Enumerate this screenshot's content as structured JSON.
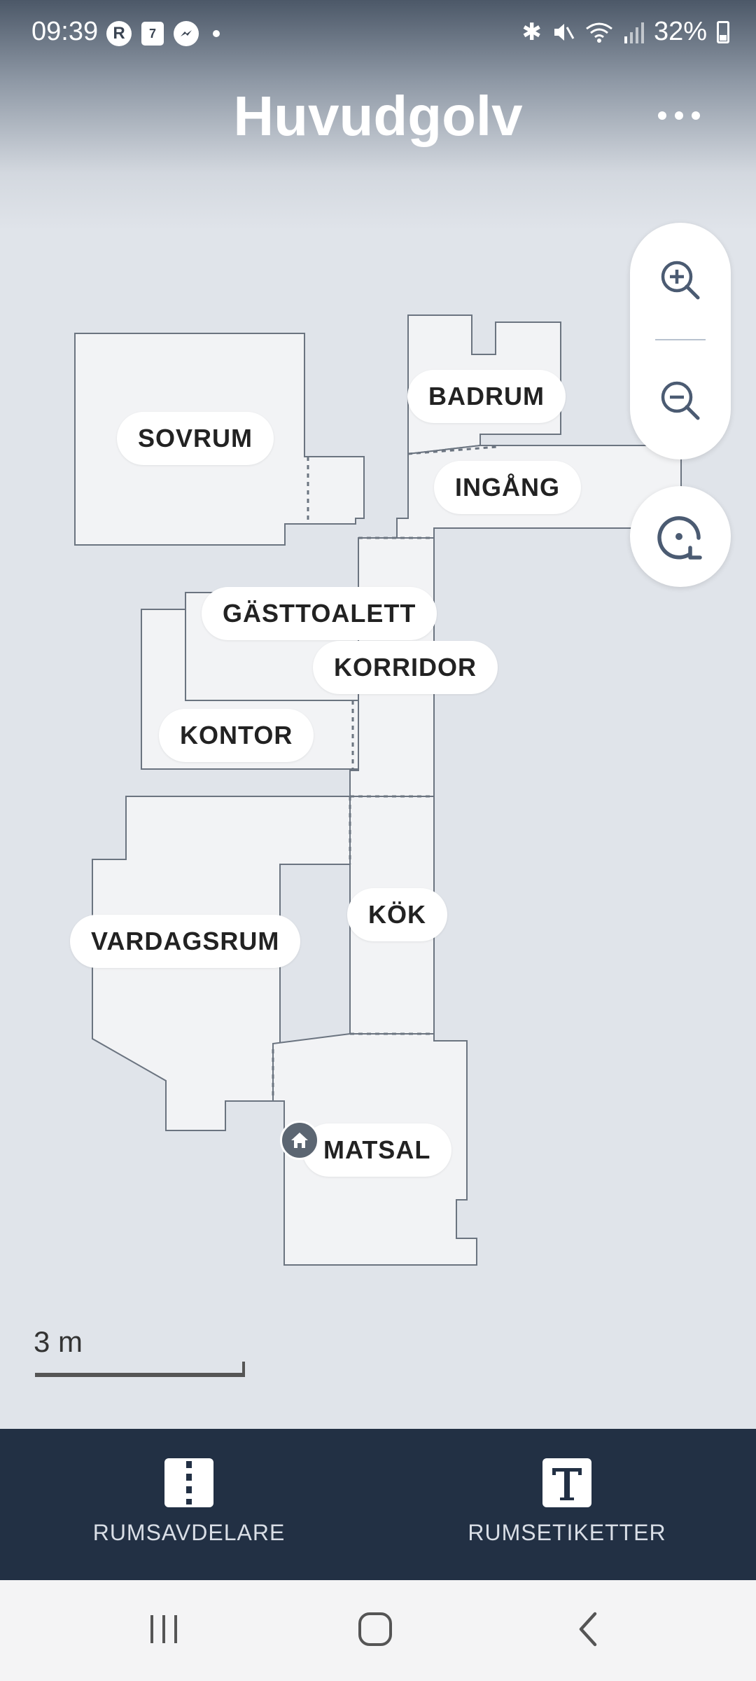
{
  "status_bar": {
    "time": "09:39",
    "notifications": [
      {
        "icon": "r-app-icon",
        "glyph": "R"
      },
      {
        "icon": "calendar-icon",
        "glyph": "7"
      },
      {
        "icon": "messenger-icon",
        "glyph": "m"
      }
    ],
    "battery_text": "32%",
    "system_icons": [
      "bluetooth-icon",
      "mute-icon",
      "wifi-icon",
      "signal-icon",
      "battery-icon"
    ]
  },
  "header": {
    "title": "Huvudgolv",
    "more_icon": "more-icon"
  },
  "map": {
    "rooms": [
      {
        "id": "sovrum",
        "label": "SOVRUM"
      },
      {
        "id": "badrum",
        "label": "BADRUM"
      },
      {
        "id": "ingang",
        "label": "INGÅNG"
      },
      {
        "id": "gasttoalett",
        "label": "GÄSTTOALETT"
      },
      {
        "id": "korridor",
        "label": "KORRIDOR"
      },
      {
        "id": "kontor",
        "label": "KONTOR"
      },
      {
        "id": "kok",
        "label": "KÖK"
      },
      {
        "id": "vardagsrum",
        "label": "VARDAGSRUM"
      },
      {
        "id": "matsal",
        "label": "MATSAL"
      }
    ],
    "dock_icon": "home-icon",
    "room_fill": "#f2f3f5",
    "wall_color": "#6b7480"
  },
  "controls": {
    "zoom_in_icon": "zoom-in-icon",
    "zoom_out_icon": "zoom-out-icon",
    "recenter_icon": "recenter-icon"
  },
  "scale": {
    "label": "3 m"
  },
  "bottom_bar": {
    "items": [
      {
        "label": "RUMSAVDELARE",
        "icon": "room-divider-icon"
      },
      {
        "label": "RUMSETIKETTER",
        "icon": "room-label-icon"
      }
    ],
    "background": "#223044"
  },
  "nav_bar": {
    "buttons": [
      "recent-apps-icon",
      "home-button-icon",
      "back-icon"
    ]
  }
}
